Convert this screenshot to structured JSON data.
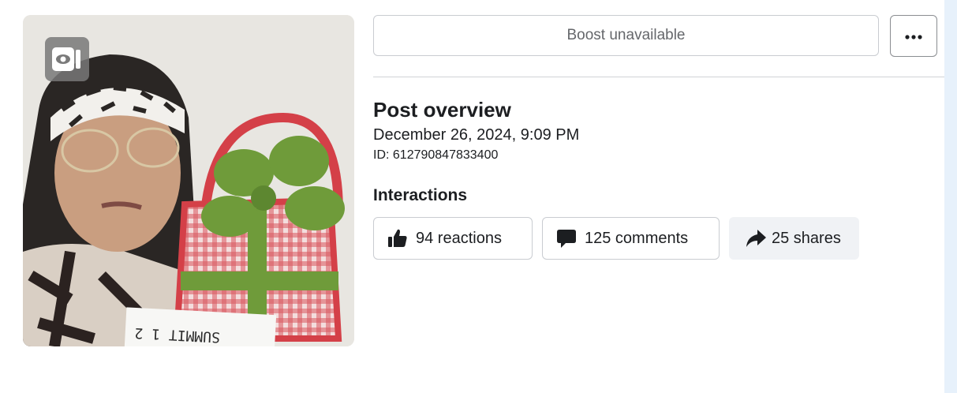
{
  "post": {
    "boost_label": "Boost unavailable",
    "more_label": "More options",
    "title": "Post overview",
    "date": "December 26, 2024, 9:09 PM",
    "id_text": "ID: 612790847833400"
  },
  "interactions": {
    "title": "Interactions",
    "reactions": "94 reactions",
    "comments": "125 comments",
    "shares": "25 shares"
  },
  "thumbnail": {
    "kind": "video",
    "sign_text": "SUMMIT 1 2"
  },
  "colors": {
    "border": "#c9ccd1",
    "muted_text": "#65676b",
    "shares_bg": "#f0f2f5",
    "scroll_strip": "#e7f1fb"
  },
  "icons": {
    "video": "video-camera-icon",
    "more": "more-dots-icon",
    "reactions": "thumbs-up-icon",
    "comments": "comment-bubble-icon",
    "shares": "share-arrow-icon"
  }
}
